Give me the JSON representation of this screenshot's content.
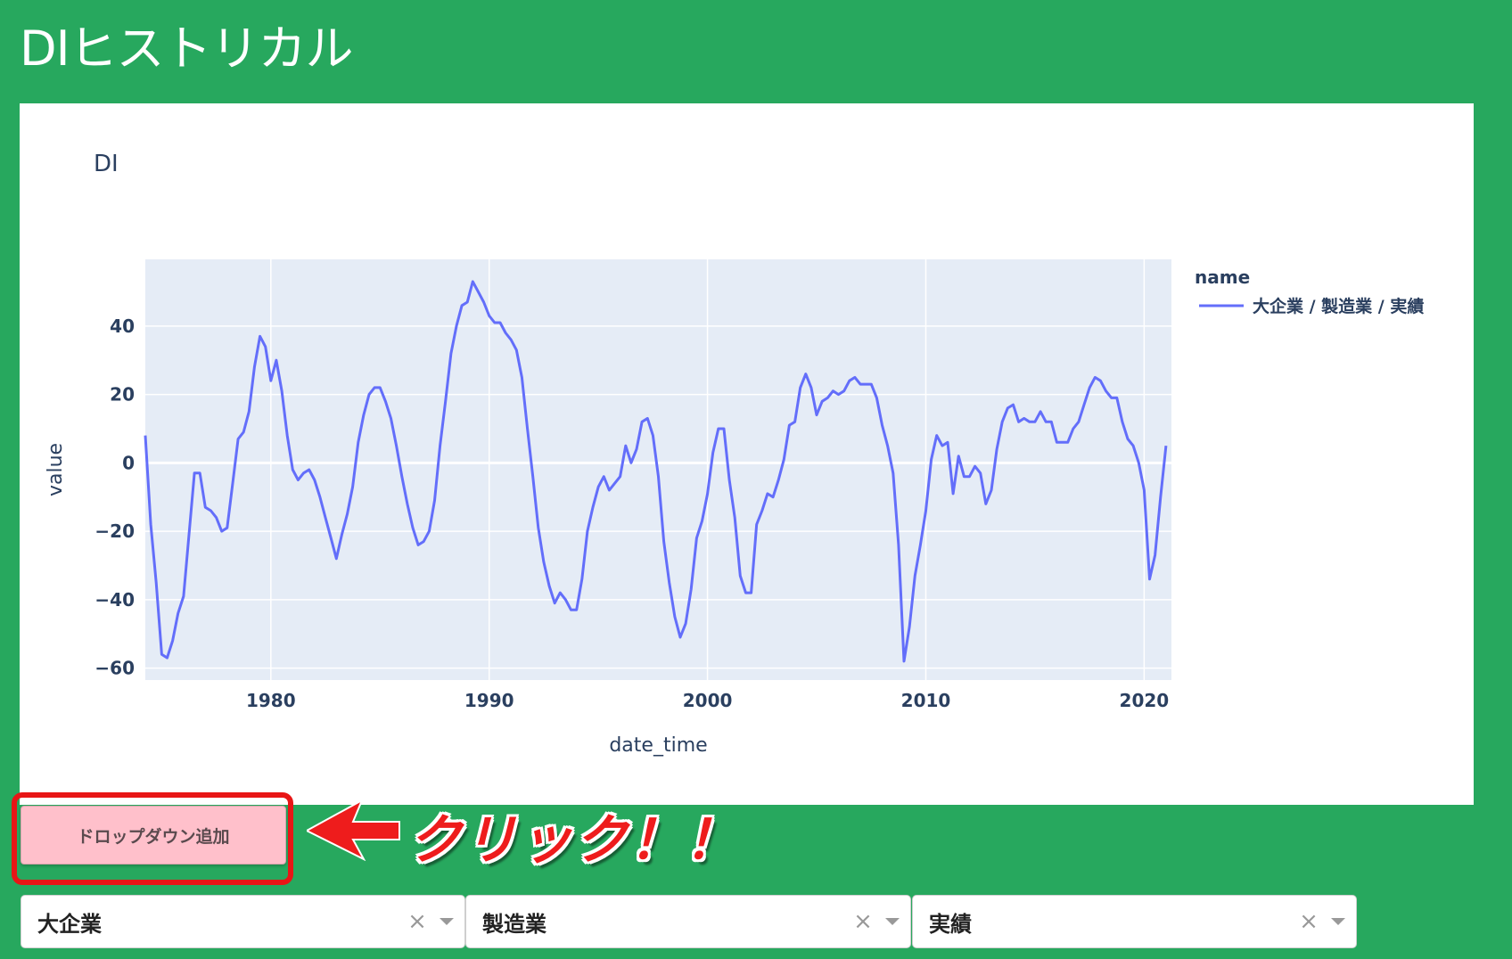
{
  "app": {
    "title": "DIヒストリカル"
  },
  "chart_data": {
    "type": "line",
    "title": "DI",
    "xlabel": "date_time",
    "ylabel": "value",
    "xlim": [
      1974.25,
      2021.25
    ],
    "ylim": [
      -63.5,
      59.5
    ],
    "x_ticks": [
      1980,
      1990,
      2000,
      2010,
      2020
    ],
    "y_ticks": [
      -60,
      -40,
      -20,
      0,
      20,
      40
    ],
    "y_tick_labels": [
      "−60",
      "−40",
      "−20",
      "0",
      "20",
      "40"
    ],
    "grid": true,
    "legend_title": "name",
    "legend_position": "top-right",
    "series": [
      {
        "name": "大企業 / 製造業 / 実績",
        "color": "#636efa",
        "points": [
          [
            1974.25,
            8
          ],
          [
            1974.5,
            -18
          ],
          [
            1974.75,
            -35
          ],
          [
            1975.0,
            -56
          ],
          [
            1975.25,
            -57
          ],
          [
            1975.5,
            -52
          ],
          [
            1975.75,
            -44
          ],
          [
            1976.0,
            -39
          ],
          [
            1976.25,
            -21
          ],
          [
            1976.5,
            -3
          ],
          [
            1976.75,
            -3
          ],
          [
            1977.0,
            -13
          ],
          [
            1977.25,
            -14
          ],
          [
            1977.5,
            -16
          ],
          [
            1977.75,
            -20
          ],
          [
            1978.0,
            -19
          ],
          [
            1978.25,
            -6
          ],
          [
            1978.5,
            7
          ],
          [
            1978.75,
            9
          ],
          [
            1979.0,
            15
          ],
          [
            1979.25,
            28
          ],
          [
            1979.5,
            37
          ],
          [
            1979.75,
            34
          ],
          [
            1980.0,
            24
          ],
          [
            1980.25,
            30
          ],
          [
            1980.5,
            21
          ],
          [
            1980.75,
            8
          ],
          [
            1981.0,
            -2
          ],
          [
            1981.25,
            -5
          ],
          [
            1981.5,
            -3
          ],
          [
            1981.75,
            -2
          ],
          [
            1982.0,
            -5
          ],
          [
            1982.25,
            -10
          ],
          [
            1982.5,
            -16
          ],
          [
            1982.75,
            -22
          ],
          [
            1983.0,
            -28
          ],
          [
            1983.25,
            -21
          ],
          [
            1983.5,
            -15
          ],
          [
            1983.75,
            -7
          ],
          [
            1984.0,
            6
          ],
          [
            1984.25,
            14
          ],
          [
            1984.5,
            20
          ],
          [
            1984.75,
            22
          ],
          [
            1985.0,
            22
          ],
          [
            1985.25,
            18
          ],
          [
            1985.5,
            13
          ],
          [
            1985.75,
            5
          ],
          [
            1986.0,
            -4
          ],
          [
            1986.25,
            -12
          ],
          [
            1986.5,
            -19
          ],
          [
            1986.75,
            -24
          ],
          [
            1987.0,
            -23
          ],
          [
            1987.25,
            -20
          ],
          [
            1987.5,
            -11
          ],
          [
            1987.75,
            5
          ],
          [
            1988.0,
            18
          ],
          [
            1988.25,
            32
          ],
          [
            1988.5,
            40
          ],
          [
            1988.75,
            46
          ],
          [
            1989.0,
            47
          ],
          [
            1989.25,
            53
          ],
          [
            1989.5,
            50
          ],
          [
            1989.75,
            47
          ],
          [
            1990.0,
            43
          ],
          [
            1990.25,
            41
          ],
          [
            1990.5,
            41
          ],
          [
            1990.75,
            38
          ],
          [
            1991.0,
            36
          ],
          [
            1991.25,
            33
          ],
          [
            1991.5,
            25
          ],
          [
            1991.75,
            10
          ],
          [
            1992.0,
            -4
          ],
          [
            1992.25,
            -19
          ],
          [
            1992.5,
            -29
          ],
          [
            1992.75,
            -36
          ],
          [
            1993.0,
            -41
          ],
          [
            1993.25,
            -38
          ],
          [
            1993.5,
            -40
          ],
          [
            1993.75,
            -43
          ],
          [
            1994.0,
            -43
          ],
          [
            1994.25,
            -34
          ],
          [
            1994.5,
            -20
          ],
          [
            1994.75,
            -13
          ],
          [
            1995.0,
            -7
          ],
          [
            1995.25,
            -4
          ],
          [
            1995.5,
            -8
          ],
          [
            1995.75,
            -6
          ],
          [
            1996.0,
            -4
          ],
          [
            1996.25,
            5
          ],
          [
            1996.5,
            0
          ],
          [
            1996.75,
            4
          ],
          [
            1997.0,
            12
          ],
          [
            1997.25,
            13
          ],
          [
            1997.5,
            8
          ],
          [
            1997.75,
            -4
          ],
          [
            1998.0,
            -23
          ],
          [
            1998.25,
            -35
          ],
          [
            1998.5,
            -45
          ],
          [
            1998.75,
            -51
          ],
          [
            1999.0,
            -47
          ],
          [
            1999.25,
            -37
          ],
          [
            1999.5,
            -22
          ],
          [
            1999.75,
            -17
          ],
          [
            2000.0,
            -9
          ],
          [
            2000.25,
            3
          ],
          [
            2000.5,
            10
          ],
          [
            2000.75,
            10
          ],
          [
            2001.0,
            -5
          ],
          [
            2001.25,
            -16
          ],
          [
            2001.5,
            -33
          ],
          [
            2001.75,
            -38
          ],
          [
            2002.0,
            -38
          ],
          [
            2002.25,
            -18
          ],
          [
            2002.5,
            -14
          ],
          [
            2002.75,
            -9
          ],
          [
            2003.0,
            -10
          ],
          [
            2003.25,
            -5
          ],
          [
            2003.5,
            1
          ],
          [
            2003.75,
            11
          ],
          [
            2004.0,
            12
          ],
          [
            2004.25,
            22
          ],
          [
            2004.5,
            26
          ],
          [
            2004.75,
            22
          ],
          [
            2005.0,
            14
          ],
          [
            2005.25,
            18
          ],
          [
            2005.5,
            19
          ],
          [
            2005.75,
            21
          ],
          [
            2006.0,
            20
          ],
          [
            2006.25,
            21
          ],
          [
            2006.5,
            24
          ],
          [
            2006.75,
            25
          ],
          [
            2007.0,
            23
          ],
          [
            2007.25,
            23
          ],
          [
            2007.5,
            23
          ],
          [
            2007.75,
            19
          ],
          [
            2008.0,
            11
          ],
          [
            2008.25,
            5
          ],
          [
            2008.5,
            -3
          ],
          [
            2008.75,
            -24
          ],
          [
            2009.0,
            -58
          ],
          [
            2009.25,
            -48
          ],
          [
            2009.5,
            -33
          ],
          [
            2009.75,
            -24
          ],
          [
            2010.0,
            -14
          ],
          [
            2010.25,
            1
          ],
          [
            2010.5,
            8
          ],
          [
            2010.75,
            5
          ],
          [
            2011.0,
            6
          ],
          [
            2011.25,
            -9
          ],
          [
            2011.5,
            2
          ],
          [
            2011.75,
            -4
          ],
          [
            2012.0,
            -4
          ],
          [
            2012.25,
            -1
          ],
          [
            2012.5,
            -3
          ],
          [
            2012.75,
            -12
          ],
          [
            2013.0,
            -8
          ],
          [
            2013.25,
            4
          ],
          [
            2013.5,
            12
          ],
          [
            2013.75,
            16
          ],
          [
            2014.0,
            17
          ],
          [
            2014.25,
            12
          ],
          [
            2014.5,
            13
          ],
          [
            2014.75,
            12
          ],
          [
            2015.0,
            12
          ],
          [
            2015.25,
            15
          ],
          [
            2015.5,
            12
          ],
          [
            2015.75,
            12
          ],
          [
            2016.0,
            6
          ],
          [
            2016.25,
            6
          ],
          [
            2016.5,
            6
          ],
          [
            2016.75,
            10
          ],
          [
            2017.0,
            12
          ],
          [
            2017.25,
            17
          ],
          [
            2017.5,
            22
          ],
          [
            2017.75,
            25
          ],
          [
            2018.0,
            24
          ],
          [
            2018.25,
            21
          ],
          [
            2018.5,
            19
          ],
          [
            2018.75,
            19
          ],
          [
            2019.0,
            12
          ],
          [
            2019.25,
            7
          ],
          [
            2019.5,
            5
          ],
          [
            2019.75,
            0
          ],
          [
            2020.0,
            -8
          ],
          [
            2020.25,
            -34
          ],
          [
            2020.5,
            -27
          ],
          [
            2020.75,
            -10
          ],
          [
            2021.0,
            5
          ]
        ]
      }
    ]
  },
  "controls": {
    "add_dropdown_label": "ドロップダウン追加",
    "callout": "クリック！！",
    "dropdowns": [
      {
        "value": "大企業",
        "clear": "×"
      },
      {
        "value": "製造業",
        "clear": "×"
      },
      {
        "value": "実績",
        "clear": "×"
      }
    ]
  },
  "colors": {
    "page_bg": "#27a85e",
    "plot_bg": "#e5ecf6",
    "line": "#636efa",
    "button_bg": "#ffc0cb",
    "highlight": "#e81616"
  }
}
